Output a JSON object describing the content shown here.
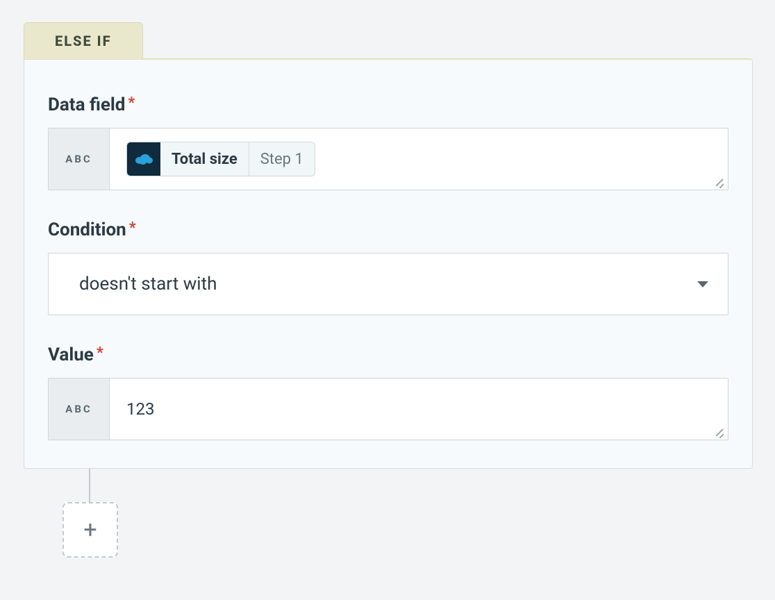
{
  "tab": {
    "label": "ELSE IF"
  },
  "labels": {
    "data_field": "Data field",
    "condition": "Condition",
    "value": "Value"
  },
  "prefix": {
    "type_abc": "ABC"
  },
  "data_field": {
    "pill_icon_name": "salesforce-icon",
    "pill_main": "Total size",
    "pill_step": "Step 1"
  },
  "condition": {
    "selected": "doesn't start with"
  },
  "value": {
    "text": "123"
  },
  "add_button": {
    "aria": "Add step"
  },
  "colors": {
    "tab_bg": "#e9e8cc",
    "card_border_top": "#e2e1c2",
    "required": "#d13f2d"
  }
}
